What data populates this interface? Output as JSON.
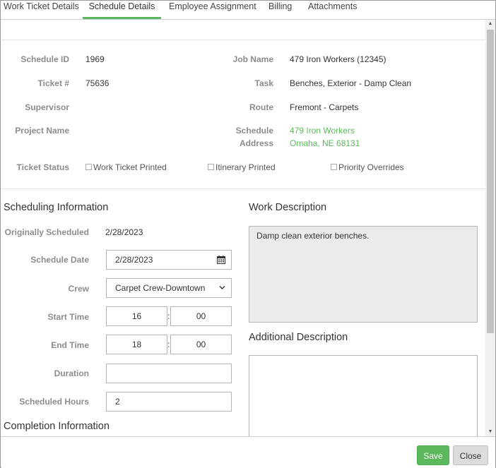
{
  "tabs": [
    {
      "label": "Work Ticket Details"
    },
    {
      "label": "Schedule Details"
    },
    {
      "label": "Employee Assignment"
    },
    {
      "label": "Billing"
    },
    {
      "label": "Attachments"
    }
  ],
  "active_tab": "Schedule Details",
  "details": {
    "schedule_id_label": "Schedule ID",
    "schedule_id_value": "1969",
    "ticket_label": "Ticket #",
    "ticket_value": "75636",
    "supervisor_label": "Supervisor",
    "supervisor_value": "",
    "project_name_label": "Project Name",
    "project_name_value": "",
    "job_name_label": "Job Name",
    "job_name_value": "479 Iron Workers (12345)",
    "task_label": "Task",
    "task_value": "Benches, Exterior - Damp Clean",
    "route_label": "Route",
    "route_value": "Fremont - Carpets",
    "schedule_address_label_1": "Schedule",
    "schedule_address_label_2": "Address",
    "schedule_address_line_1": "479 Iron Workers",
    "schedule_address_line_2": "Omaha, NE 68131"
  },
  "ticket_status": {
    "label": "Ticket Status",
    "work_ticket_printed": "Work Ticket Printed",
    "itinerary_printed": "Itinerary Printed",
    "priority_overrides": "Priority Overrides"
  },
  "scheduling": {
    "title": "Scheduling Information",
    "originally_scheduled_label": "Originally Scheduled",
    "originally_scheduled_value": "2/28/2023",
    "schedule_date_label": "Schedule Date",
    "schedule_date_value": "2/28/2023",
    "crew_label": "Crew",
    "crew_value": "Carpet Crew-Downtown",
    "start_time_label": "Start Time",
    "start_hour": "16",
    "start_minute": "00",
    "end_time_label": "End Time",
    "end_hour": "18",
    "end_minute": "00",
    "duration_label": "Duration",
    "duration_value": "",
    "scheduled_hours_label": "Scheduled Hours",
    "scheduled_hours_value": "2",
    "time_separator": ":"
  },
  "completion": {
    "title": "Completion Information"
  },
  "work_description": {
    "title": "Work Description",
    "value": "Damp clean exterior benches."
  },
  "additional_description": {
    "title": "Additional Description",
    "value": ""
  },
  "footer": {
    "save_label": "Save",
    "close_label": "Close"
  },
  "colors": {
    "accent": "#5cb85c",
    "label_gray": "#8c8c8c",
    "readonly_bg": "#ebebeb"
  },
  "icons": {
    "calendar": "calendar-icon",
    "dropdown": "chevron-down-icon",
    "scroll_up": "scroll-up-arrow-icon",
    "scroll_down": "scroll-down-arrow-icon"
  }
}
